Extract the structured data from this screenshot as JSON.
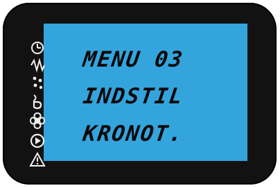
{
  "display": {
    "line1": "MENU 03",
    "line2": "INDSTIL",
    "line3": "KRONOT."
  },
  "icons": [
    "timer-icon",
    "heating-element-icon",
    "steam-icon",
    "bottom-heat-icon",
    "convection-fan-icon",
    "play-icon",
    "warning-icon"
  ],
  "colors": {
    "bezel": "#121212",
    "lcd_background": "#34a4dd",
    "lcd_text": "#0a0a0a",
    "icon_color": "#f2f2f2"
  }
}
